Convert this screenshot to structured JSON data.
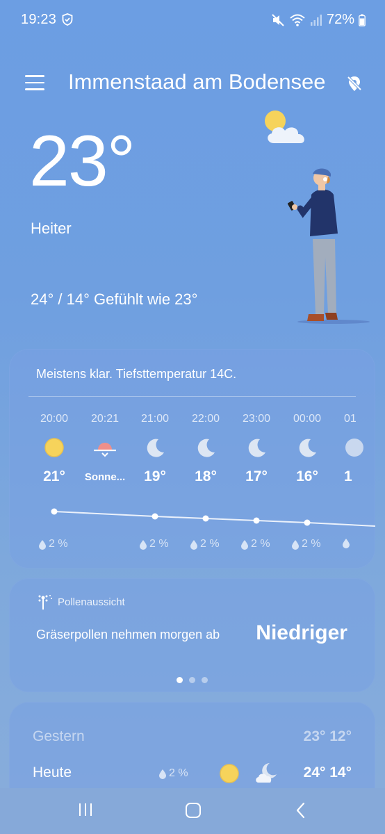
{
  "status": {
    "time": "19:23",
    "battery": "72%"
  },
  "header": {
    "location": "Immenstaad am Bodensee",
    "menu_icon": "menu-icon",
    "location_icon": "location-off-icon"
  },
  "current": {
    "temperature": "23°",
    "condition": "Heiter",
    "range_text": "24° / 14°",
    "feels_like": "Gefühlt wie 23°",
    "icon": "partly-cloudy-icon"
  },
  "hourly": {
    "summary": "Meistens klar. Tiefsttemperatur 14C.",
    "items": [
      {
        "time": "20:00",
        "icon": "sun-icon",
        "temp": "21°",
        "precip": "2 %"
      },
      {
        "time": "20:21",
        "icon": "sunset-icon",
        "temp": "Sonne...",
        "precip": ""
      },
      {
        "time": "21:00",
        "icon": "moon-icon",
        "temp": "19°",
        "precip": "2 %"
      },
      {
        "time": "22:00",
        "icon": "moon-icon",
        "temp": "18°",
        "precip": "2 %"
      },
      {
        "time": "23:00",
        "icon": "moon-icon",
        "temp": "17°",
        "precip": "2 %"
      },
      {
        "time": "00:00",
        "icon": "moon-icon",
        "temp": "16°",
        "precip": "2 %"
      },
      {
        "time": "01",
        "icon": "moon-icon",
        "temp": "1",
        "precip": ""
      }
    ]
  },
  "pollen": {
    "title": "Pollenaussicht",
    "description": "Gräserpollen nehmen morgen ab",
    "level": "Niedriger"
  },
  "daily": [
    {
      "day": "Gestern",
      "temps": "23° 12°",
      "precip": ""
    },
    {
      "day": "Heute",
      "temps": "24° 14°",
      "precip": "2 %"
    }
  ],
  "colors": {
    "background": "#6f9fe0",
    "sun": "#f6d35b",
    "sunset": "#ef8f8a"
  }
}
